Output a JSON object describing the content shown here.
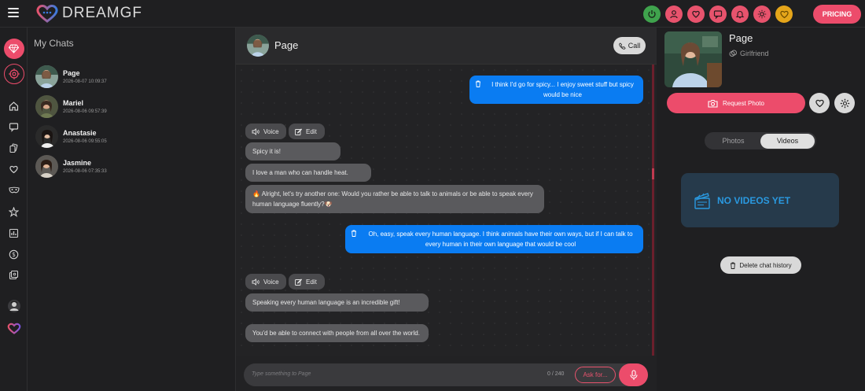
{
  "app": {
    "logo_text": "DREAMGF",
    "pricing_label": "PRICING",
    "accent": "#ec4c6b",
    "user_bubble_color": "#0a7cf2"
  },
  "topbar": {
    "icons": [
      "power-icon",
      "profile-icon",
      "heart-icon",
      "chat-icon",
      "bell-icon",
      "sun-icon",
      "heart-gold-icon"
    ]
  },
  "rail": {
    "items": [
      "diamond-icon",
      "target-icon",
      "home-icon",
      "chat-icon",
      "cards-icon",
      "heart-icon",
      "mask-icon",
      "star-icon",
      "gallery-icon",
      "dollar-icon",
      "pictures-icon",
      "avatar",
      "logo-heart-icon"
    ]
  },
  "chatlist": {
    "title": "My Chats",
    "chats": [
      {
        "name": "Page",
        "time": "2026-08-07 10:09:37"
      },
      {
        "name": "Mariel",
        "time": "2026-08-06 09:57:39"
      },
      {
        "name": "Anastasie",
        "time": "2026-08-06 09:55:05"
      },
      {
        "name": "Jasmine",
        "time": "2026-08-06 07:35:33"
      }
    ]
  },
  "chat": {
    "title": "Page",
    "call_label": "Call",
    "voice_label": "Voice",
    "edit_label": "Edit",
    "messages": [
      {
        "from": "user",
        "text": "I think I'd go for spicy... I enjoy sweet stuff but spicy would be nice"
      },
      {
        "from": "bot",
        "text": "Spicy it is!"
      },
      {
        "from": "bot",
        "text": "I love a man who can handle heat."
      },
      {
        "from": "bot",
        "text": "🔥 Alright, let's try another one: Would you rather be able to talk to animals or be able to speak every human language fluently?🐶"
      },
      {
        "from": "user",
        "text": "Oh, easy, speak every human language. I think animals have their own ways, but if I can talk to every human in their own language that would be cool"
      },
      {
        "from": "bot",
        "text": "Speaking every human language is an incredible gift!"
      },
      {
        "from": "bot",
        "text": "You'd be able to connect with people from all over the world."
      }
    ],
    "composer": {
      "placeholder": "Type something to Page",
      "count": "0 / 240",
      "ask_label": "Ask for..."
    }
  },
  "profile": {
    "name": "Page",
    "role": "Girlfriend",
    "request_photo_label": "Request Photo",
    "tabs": [
      "Photos",
      "Videos"
    ],
    "active_tab": "Videos",
    "empty_text": "NO VIDEOS YET",
    "delete_label": "Delete chat history"
  }
}
